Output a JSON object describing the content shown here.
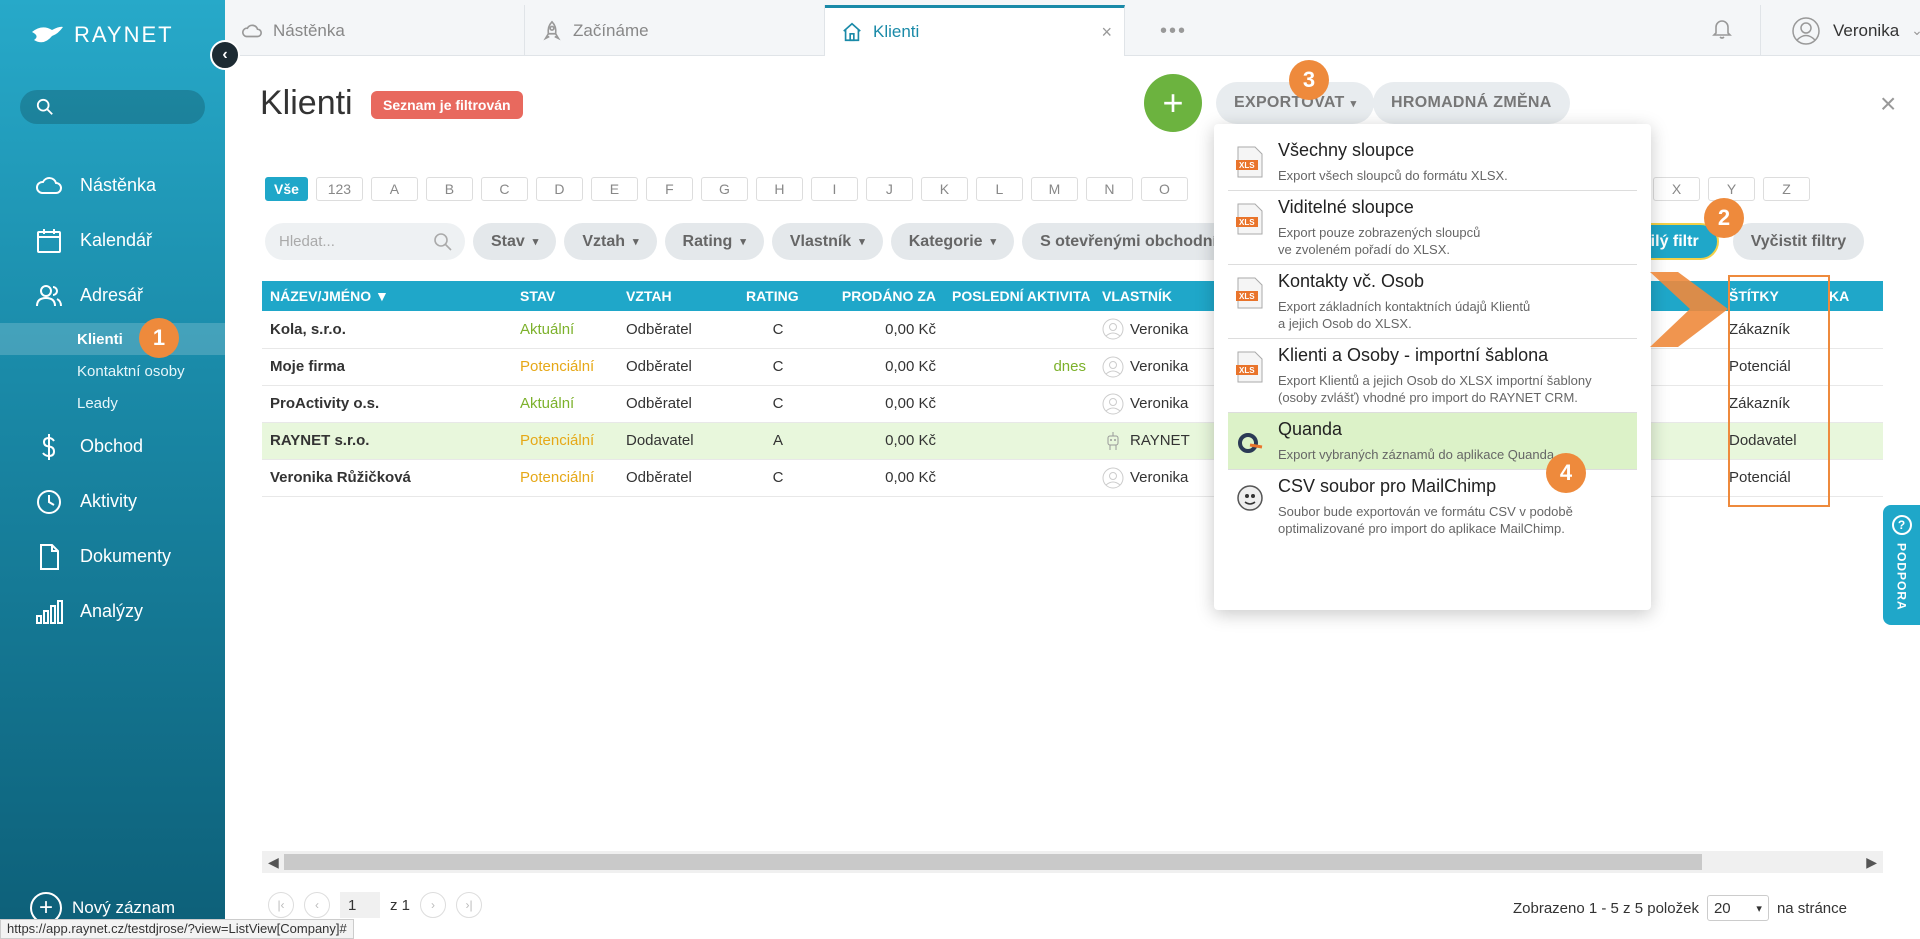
{
  "brand": {
    "logo_text": "RAYNET"
  },
  "sidebar": {
    "search_placeholder": "",
    "items": [
      {
        "label": "Nástěnka",
        "icon": "cloud-icon"
      },
      {
        "label": "Kalendář",
        "icon": "calendar-icon"
      },
      {
        "label": "Adresář",
        "icon": "contacts-icon"
      },
      {
        "label": "Obchod",
        "icon": "dollar-icon"
      },
      {
        "label": "Aktivity",
        "icon": "clock-icon"
      },
      {
        "label": "Dokumenty",
        "icon": "document-icon"
      },
      {
        "label": "Analýzy",
        "icon": "bar-chart-icon"
      }
    ],
    "subitems": [
      {
        "label": "Klienti",
        "active": true
      },
      {
        "label": "Kontaktní osoby",
        "active": false
      },
      {
        "label": "Leady",
        "active": false
      }
    ],
    "new_record": "Nový záznam"
  },
  "tabs": [
    {
      "label": "Nástěnka",
      "icon": "cloud-icon",
      "active": false
    },
    {
      "label": "Začínáme",
      "icon": "rocket-icon",
      "active": false
    },
    {
      "label": "Klienti",
      "icon": "home-icon",
      "active": true
    }
  ],
  "tabs_more": "•••",
  "user": {
    "name": "Veronika"
  },
  "header": {
    "title": "Klienti",
    "filter_badge": "Seznam je filtrován",
    "add": "+",
    "export_label": "EXPORTOVAT",
    "bulk_change_label": "HROMADNÁ ZMĚNA",
    "close": "×"
  },
  "alphabet": [
    "Vše",
    "123",
    "A",
    "B",
    "C",
    "D",
    "E",
    "F",
    "G",
    "H",
    "I",
    "J",
    "K",
    "L",
    "M",
    "N",
    "O"
  ],
  "alphabet_tail": [
    "X",
    "Y",
    "Z"
  ],
  "filters": {
    "search_placeholder": "Hledat...",
    "buttons": [
      "Stav",
      "Vztah",
      "Rating",
      "Vlastník",
      "Kategorie"
    ],
    "opened_deals": "S otevřenými obchodními příp",
    "saved_filter": "očilý filtr",
    "clear_filters": "Vyčistit filtry"
  },
  "table": {
    "columns": [
      "NÁZEV/JMÉNO",
      "STAV",
      "VZTAH",
      "RATING",
      "PRODÁNO ZA",
      "POSLEDNÍ AKTIVITA",
      "VLASTNÍK",
      "ŠTÍTKY",
      "KA"
    ],
    "rows": [
      {
        "name": "Kola, s.r.o.",
        "status": "Aktuální",
        "relation": "Odběratel",
        "rating": "C",
        "sold": "0,00 Kč",
        "last_activity": "",
        "owner": "Veronika",
        "tag": "Zákazník"
      },
      {
        "name": "Moje firma",
        "status": "Potenciální",
        "relation": "Odběratel",
        "rating": "C",
        "sold": "0,00 Kč",
        "last_activity": "dnes",
        "owner": "Veronika",
        "tag": "Potenciál"
      },
      {
        "name": "ProActivity o.s.",
        "status": "Aktuální",
        "relation": "Odběratel",
        "rating": "C",
        "sold": "0,00 Kč",
        "last_activity": "",
        "owner": "Veronika",
        "tag": "Zákazník"
      },
      {
        "name": "RAYNET s.r.o.",
        "status": "Potenciální",
        "relation": "Dodavatel",
        "rating": "A",
        "sold": "0,00 Kč",
        "last_activity": "",
        "owner": "RAYNET",
        "tag": "Dodavatel"
      },
      {
        "name": "Veronika Růžičková",
        "status": "Potenciální",
        "relation": "Odběratel",
        "rating": "C",
        "sold": "0,00 Kč",
        "last_activity": "",
        "owner": "Veronika",
        "tag": "Potenciál"
      }
    ]
  },
  "export_menu": [
    {
      "title": "Všechny sloupce",
      "desc": "Export všech sloupců do formátu XLSX.",
      "icon": "xlsx-file-icon"
    },
    {
      "title": "Viditelné sloupce",
      "desc": "Export pouze zobrazených sloupců\nve zvoleném pořadí do XLSX.",
      "icon": "xlsx-file-icon"
    },
    {
      "title": "Kontakty vč. Osob",
      "desc": "Export základních kontaktních údajů Klientů\na jejich Osob do XLSX.",
      "icon": "xlsx-file-icon"
    },
    {
      "title": "Klienti a Osoby - importní šablona",
      "desc": "Export Klientů a jejich Osob do XLSX importní šablony\n(osoby zvlášť) vhodné pro import do RAYNET CRM.",
      "icon": "xlsx-file-icon"
    },
    {
      "title": "Quanda",
      "desc": "Export vybraných záznamů do aplikace Quanda",
      "icon": "quanda-icon",
      "highlighted": true
    },
    {
      "title": "CSV soubor pro MailChimp",
      "desc": "Soubor bude exportován ve formátu CSV v podobě\noptimalizované pro import do aplikace MailChimp.",
      "icon": "mailchimp-icon"
    }
  ],
  "xlsx_label": "XLS",
  "step_badges": [
    "1",
    "2",
    "3",
    "4"
  ],
  "pagination": {
    "page": "1",
    "of": "z 1",
    "info": "Zobrazeno 1 - 5 z 5 položek",
    "per_page": "20",
    "per_page_suffix": "na stránce"
  },
  "support_label": "PODPORA",
  "status_url": "https://app.raynet.cz/testdjrose/?view=ListView[Company]#",
  "colors": {
    "accent": "#1fa7c9",
    "badge": "#ee8a3c",
    "add": "#6cb33f",
    "filter_badge": "#e8695e"
  }
}
